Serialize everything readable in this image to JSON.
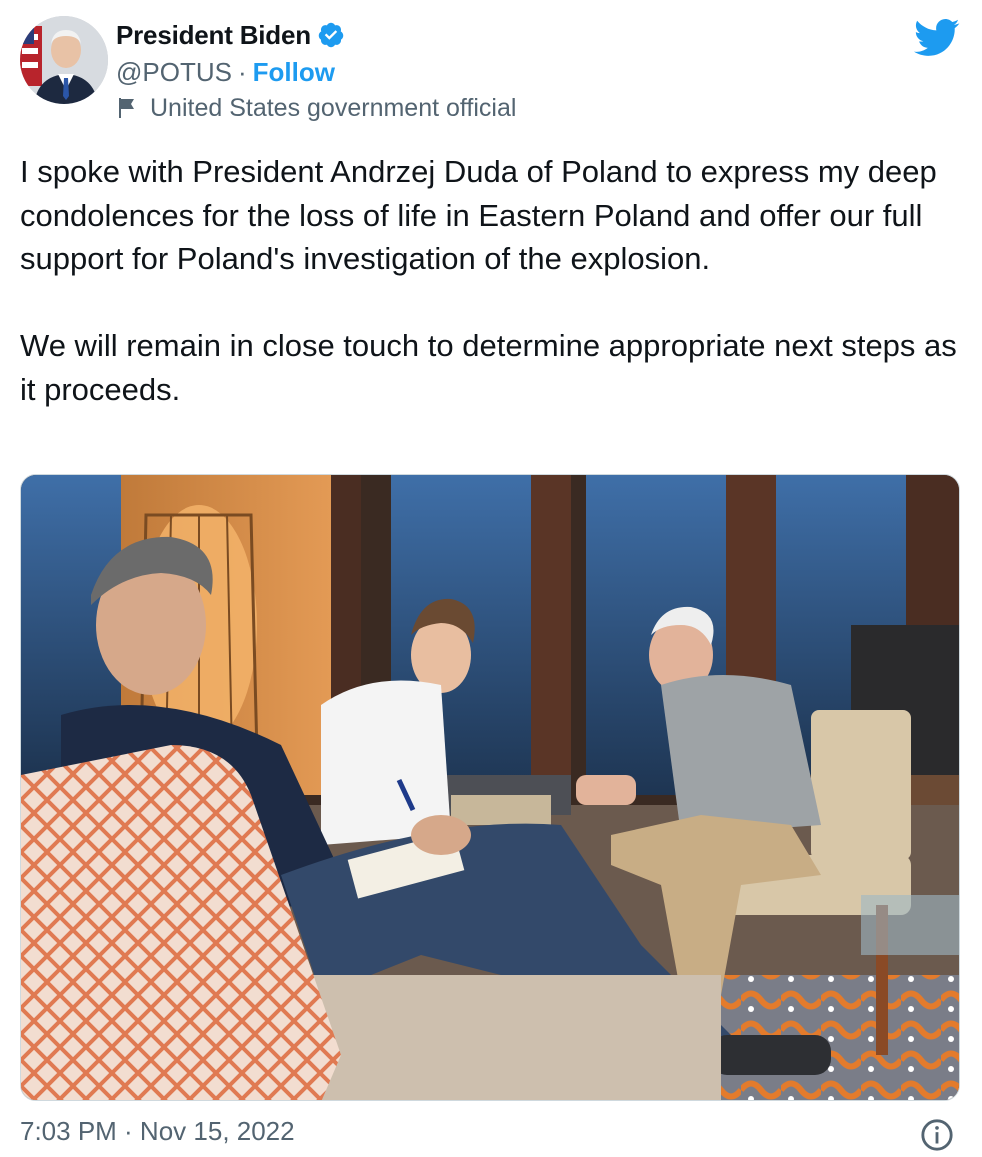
{
  "author": {
    "display_name": "President Biden",
    "handle": "@POTUS",
    "separator": "·",
    "follow_label": "Follow",
    "account_label": "United States government official",
    "verified": true
  },
  "tweet": {
    "paragraphs": [
      "I spoke with President Andrzej Duda of Poland to express my deep condolences for the loss of life in Eastern Poland and offer our full support for Poland's investigation of the explosion.",
      "We will remain in close touch to determine appropriate next steps as it proceeds."
    ],
    "timestamp": "7:03 PM · Nov 15, 2022"
  },
  "icons": {
    "verified": "verified-badge-icon",
    "flag": "flag-icon",
    "logo": "twitter-bird-icon",
    "info": "info-icon"
  },
  "colors": {
    "accent": "#1d9bf0",
    "text_primary": "#0f1419",
    "text_secondary": "#536471",
    "border": "#cfd9de"
  }
}
